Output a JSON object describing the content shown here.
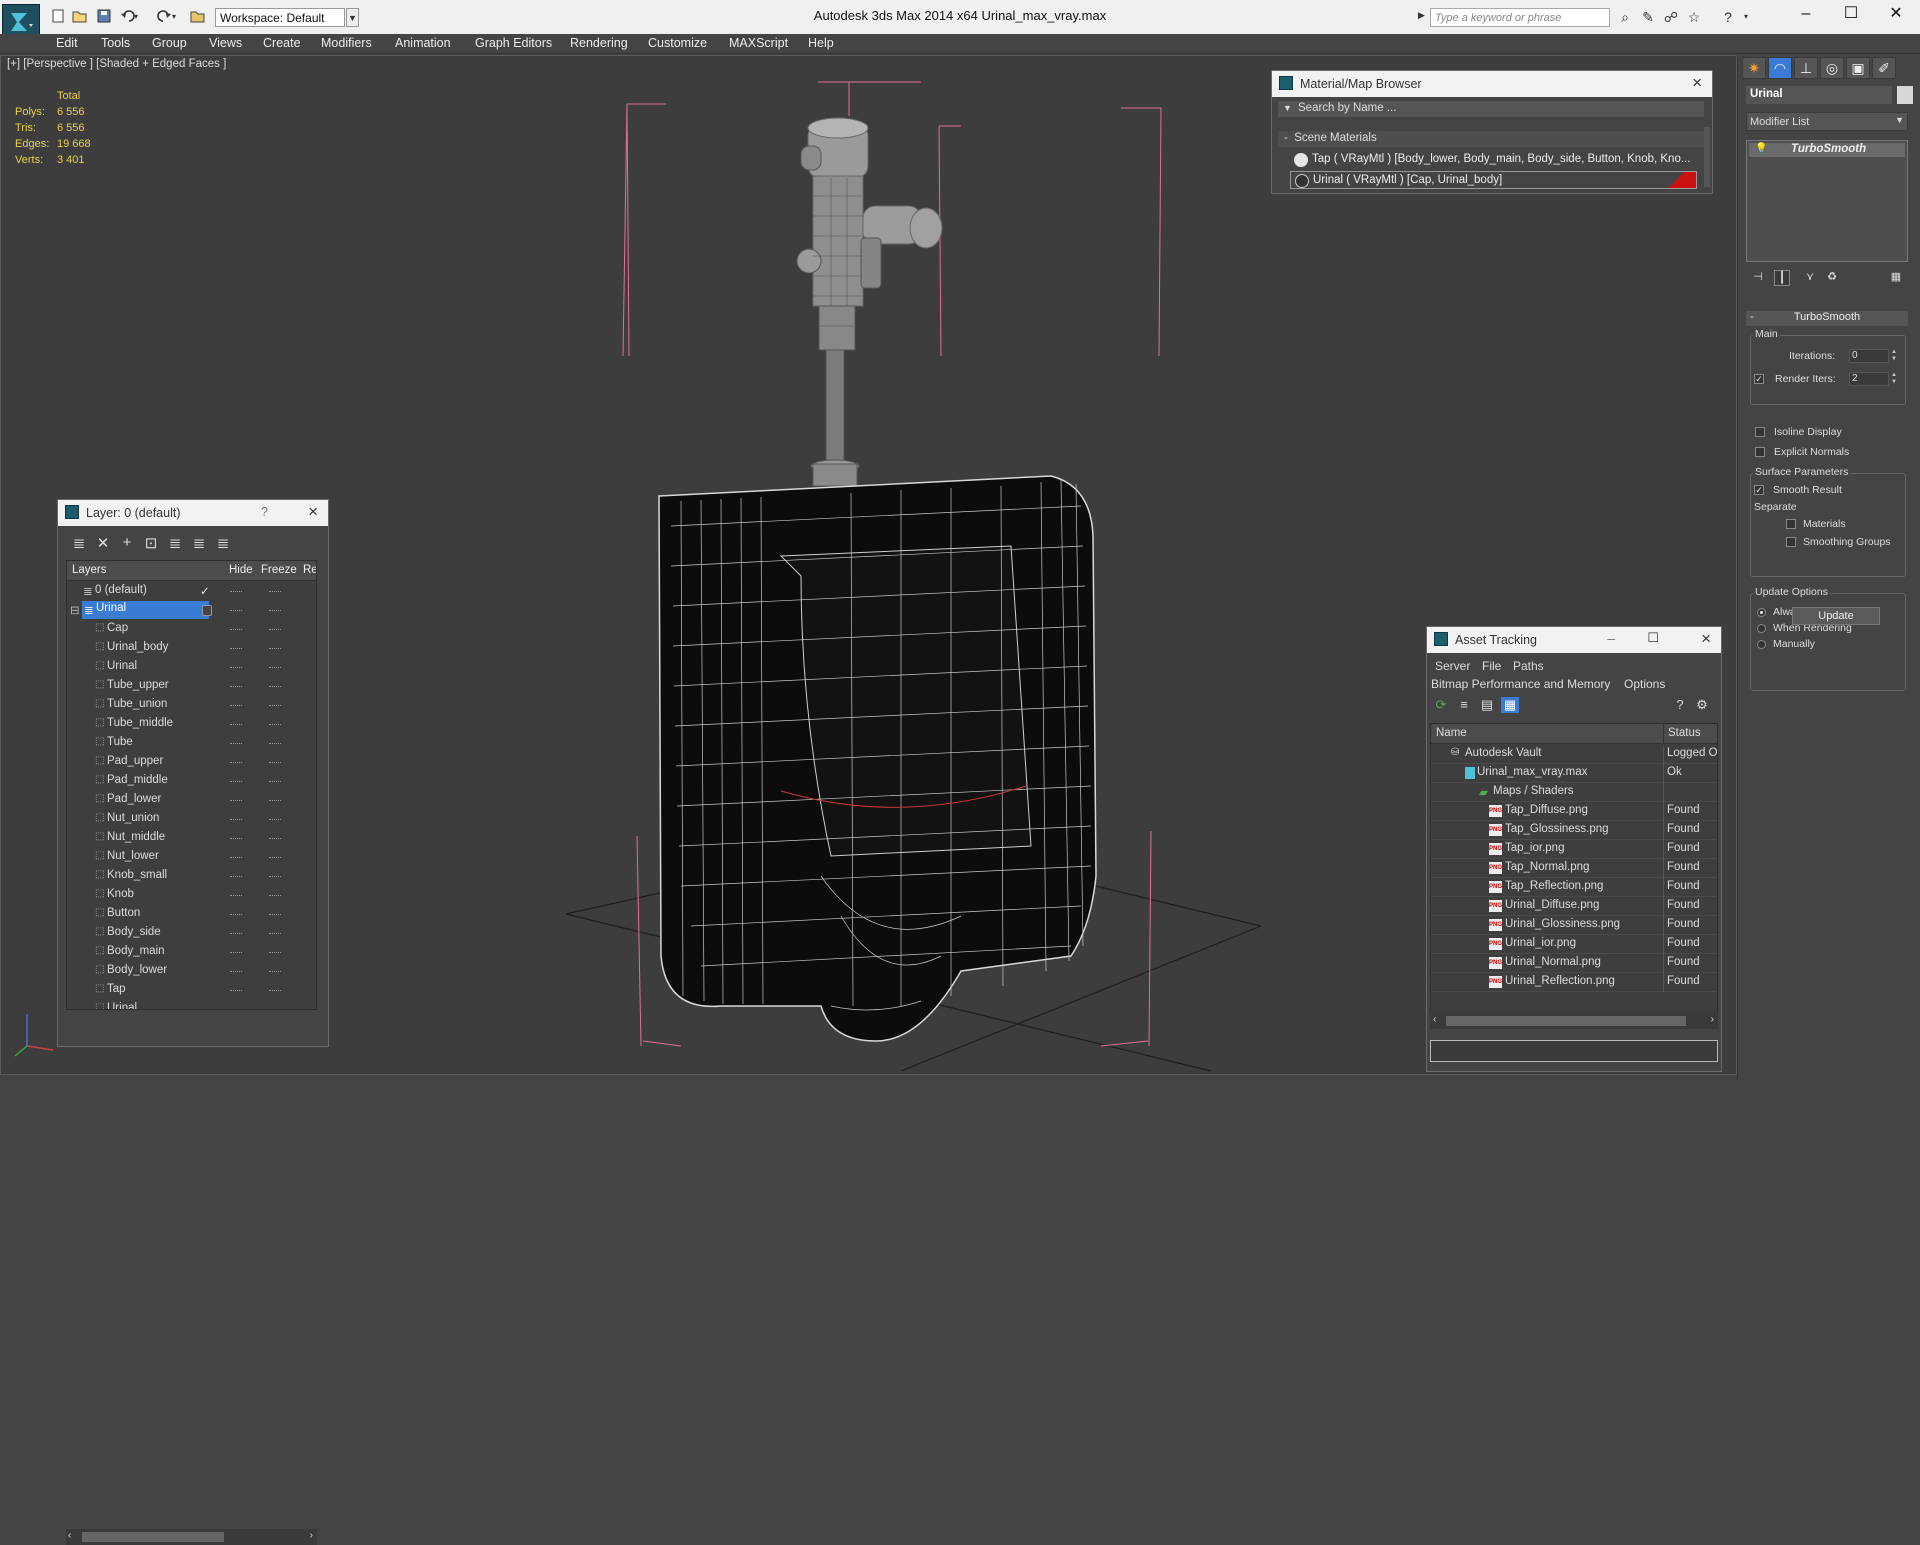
{
  "titlebar": {
    "workspace": "Workspace: Default",
    "window_title": "Autodesk 3ds Max  2014 x64      Urinal_max_vray.max",
    "search_placeholder": "Type a keyword or phrase"
  },
  "menu": [
    "Edit",
    "Tools",
    "Group",
    "Views",
    "Create",
    "Modifiers",
    "Animation",
    "Graph Editors",
    "Rendering",
    "Customize",
    "MAXScript",
    "Help"
  ],
  "viewport": {
    "label": "[+] [Perspective ] [Shaded + Edged Faces ]",
    "stats": {
      "header": "Total",
      "rows": [
        {
          "label": "Polys:",
          "value": "6 556"
        },
        {
          "label": "Tris:",
          "value": "6 556"
        },
        {
          "label": "Edges:",
          "value": "19 668"
        },
        {
          "label": "Verts:",
          "value": "3 401"
        }
      ]
    }
  },
  "material_browser": {
    "title": "Material/Map Browser",
    "search": "Search by Name ...",
    "group": "Scene Materials",
    "rows": [
      "Tap  ( VRayMtl ) [Body_lower, Body_main, Body_side, Button, Knob, Kno...",
      "Urinal  ( VRayMtl ) [Cap, Urinal_body]"
    ]
  },
  "layer_manager": {
    "title": "Layer: 0 (default)",
    "help": "?",
    "columns": [
      "Layers",
      "Hide",
      "Freeze",
      "Re"
    ],
    "layers": [
      {
        "name": "0 (default)"
      },
      {
        "name": "Urinal"
      }
    ],
    "objects": [
      "Cap",
      "Urinal_body",
      "Urinal",
      "Tube_upper",
      "Tube_union",
      "Tube_middle",
      "Tube",
      "Pad_upper",
      "Pad_middle",
      "Pad_lower",
      "Nut_union",
      "Nut_middle",
      "Nut_lower",
      "Knob_small",
      "Knob",
      "Button",
      "Body_side",
      "Body_main",
      "Body_lower",
      "Tap",
      "Urinal"
    ]
  },
  "asset_tracking": {
    "title": "Asset Tracking",
    "menu1": [
      "Server",
      "File",
      "Paths"
    ],
    "menu2": [
      "Bitmap Performance and Memory",
      "Options"
    ],
    "columns": [
      "Name",
      "Status"
    ],
    "rows": [
      {
        "name": "Autodesk Vault",
        "status": "Logged Out"
      },
      {
        "name": "Urinal_max_vray.max",
        "status": "Ok"
      },
      {
        "name": "Maps / Shaders",
        "status": ""
      },
      {
        "name": "Tap_Diffuse.png",
        "status": "Found"
      },
      {
        "name": "Tap_Glossiness.png",
        "status": "Found"
      },
      {
        "name": "Tap_ior.png",
        "status": "Found"
      },
      {
        "name": "Tap_Normal.png",
        "status": "Found"
      },
      {
        "name": "Tap_Reflection.png",
        "status": "Found"
      },
      {
        "name": "Urinal_Diffuse.png",
        "status": "Found"
      },
      {
        "name": "Urinal_Glossiness.png",
        "status": "Found"
      },
      {
        "name": "Urinal_ior.png",
        "status": "Found"
      },
      {
        "name": "Urinal_Normal.png",
        "status": "Found"
      },
      {
        "name": "Urinal_Reflection.png",
        "status": "Found"
      }
    ],
    "file_icon_text": "PNG"
  },
  "command_panel": {
    "object_name": "Urinal",
    "modifier_list": "Modifier List",
    "stack_item": "TurboSmooth",
    "rollout_title": "TurboSmooth",
    "rollout_toggle": "-",
    "main_label": "Main",
    "iterations_label": "Iterations:",
    "iterations_value": "0",
    "render_iters_label": "Render Iters:",
    "render_iters_value": "2",
    "isoline": "Isoline Display",
    "explicit": "Explicit Normals",
    "surface_label": "Surface Parameters",
    "smooth_result": "Smooth Result",
    "separate_label": "Separate",
    "materials": "Materials",
    "smoothing_groups": "Smoothing Groups",
    "update_label": "Update Options",
    "always": "Always",
    "when_rendering": "When Rendering",
    "manually": "Manually",
    "update_button": "Update"
  },
  "colors": {
    "accent_blue": "#3a7bd5",
    "stats_yellow": "#e8d24a",
    "bbox_pink": "#e0709a",
    "urinal_swatch": "#cc1111"
  }
}
